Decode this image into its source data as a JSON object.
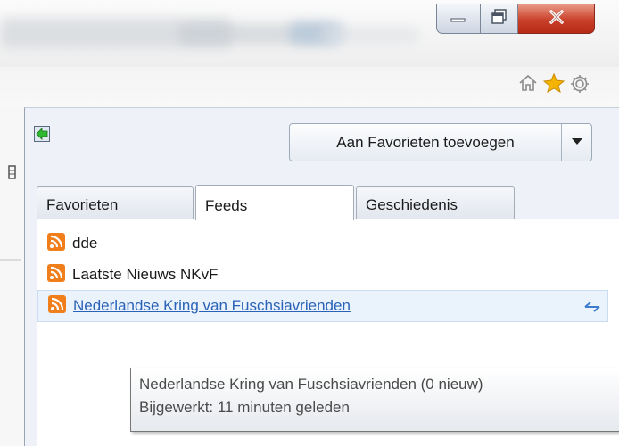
{
  "window": {
    "minimize_icon": "minimize-icon",
    "maximize_icon": "restore-icon",
    "close_icon": "close-icon"
  },
  "toolbar": {
    "icons": [
      "home-icon",
      "favorites-star-icon",
      "settings-gear-icon"
    ],
    "accent_star": "#f5b400"
  },
  "favorites_center": {
    "add_button_label": "Aan Favorieten toevoegen",
    "tabs": [
      {
        "label": "Favorieten",
        "active": false
      },
      {
        "label": "Feeds",
        "active": true
      },
      {
        "label": "Geschiedenis",
        "active": false
      }
    ],
    "feeds": [
      {
        "label": "dde",
        "selected": false
      },
      {
        "label": "Laatste Nieuws NKvF",
        "selected": false
      },
      {
        "label": "Nederlandse Kring van Fuschsiavrienden",
        "selected": true
      }
    ],
    "rss_color": "#f07e1a",
    "selected_link_color": "#2a62b7"
  },
  "tooltip": {
    "line1": "Nederlandse Kring van Fuschsiavrienden (0 nieuw)",
    "line2": "Bijgewerkt: 11 minuten geleden"
  }
}
